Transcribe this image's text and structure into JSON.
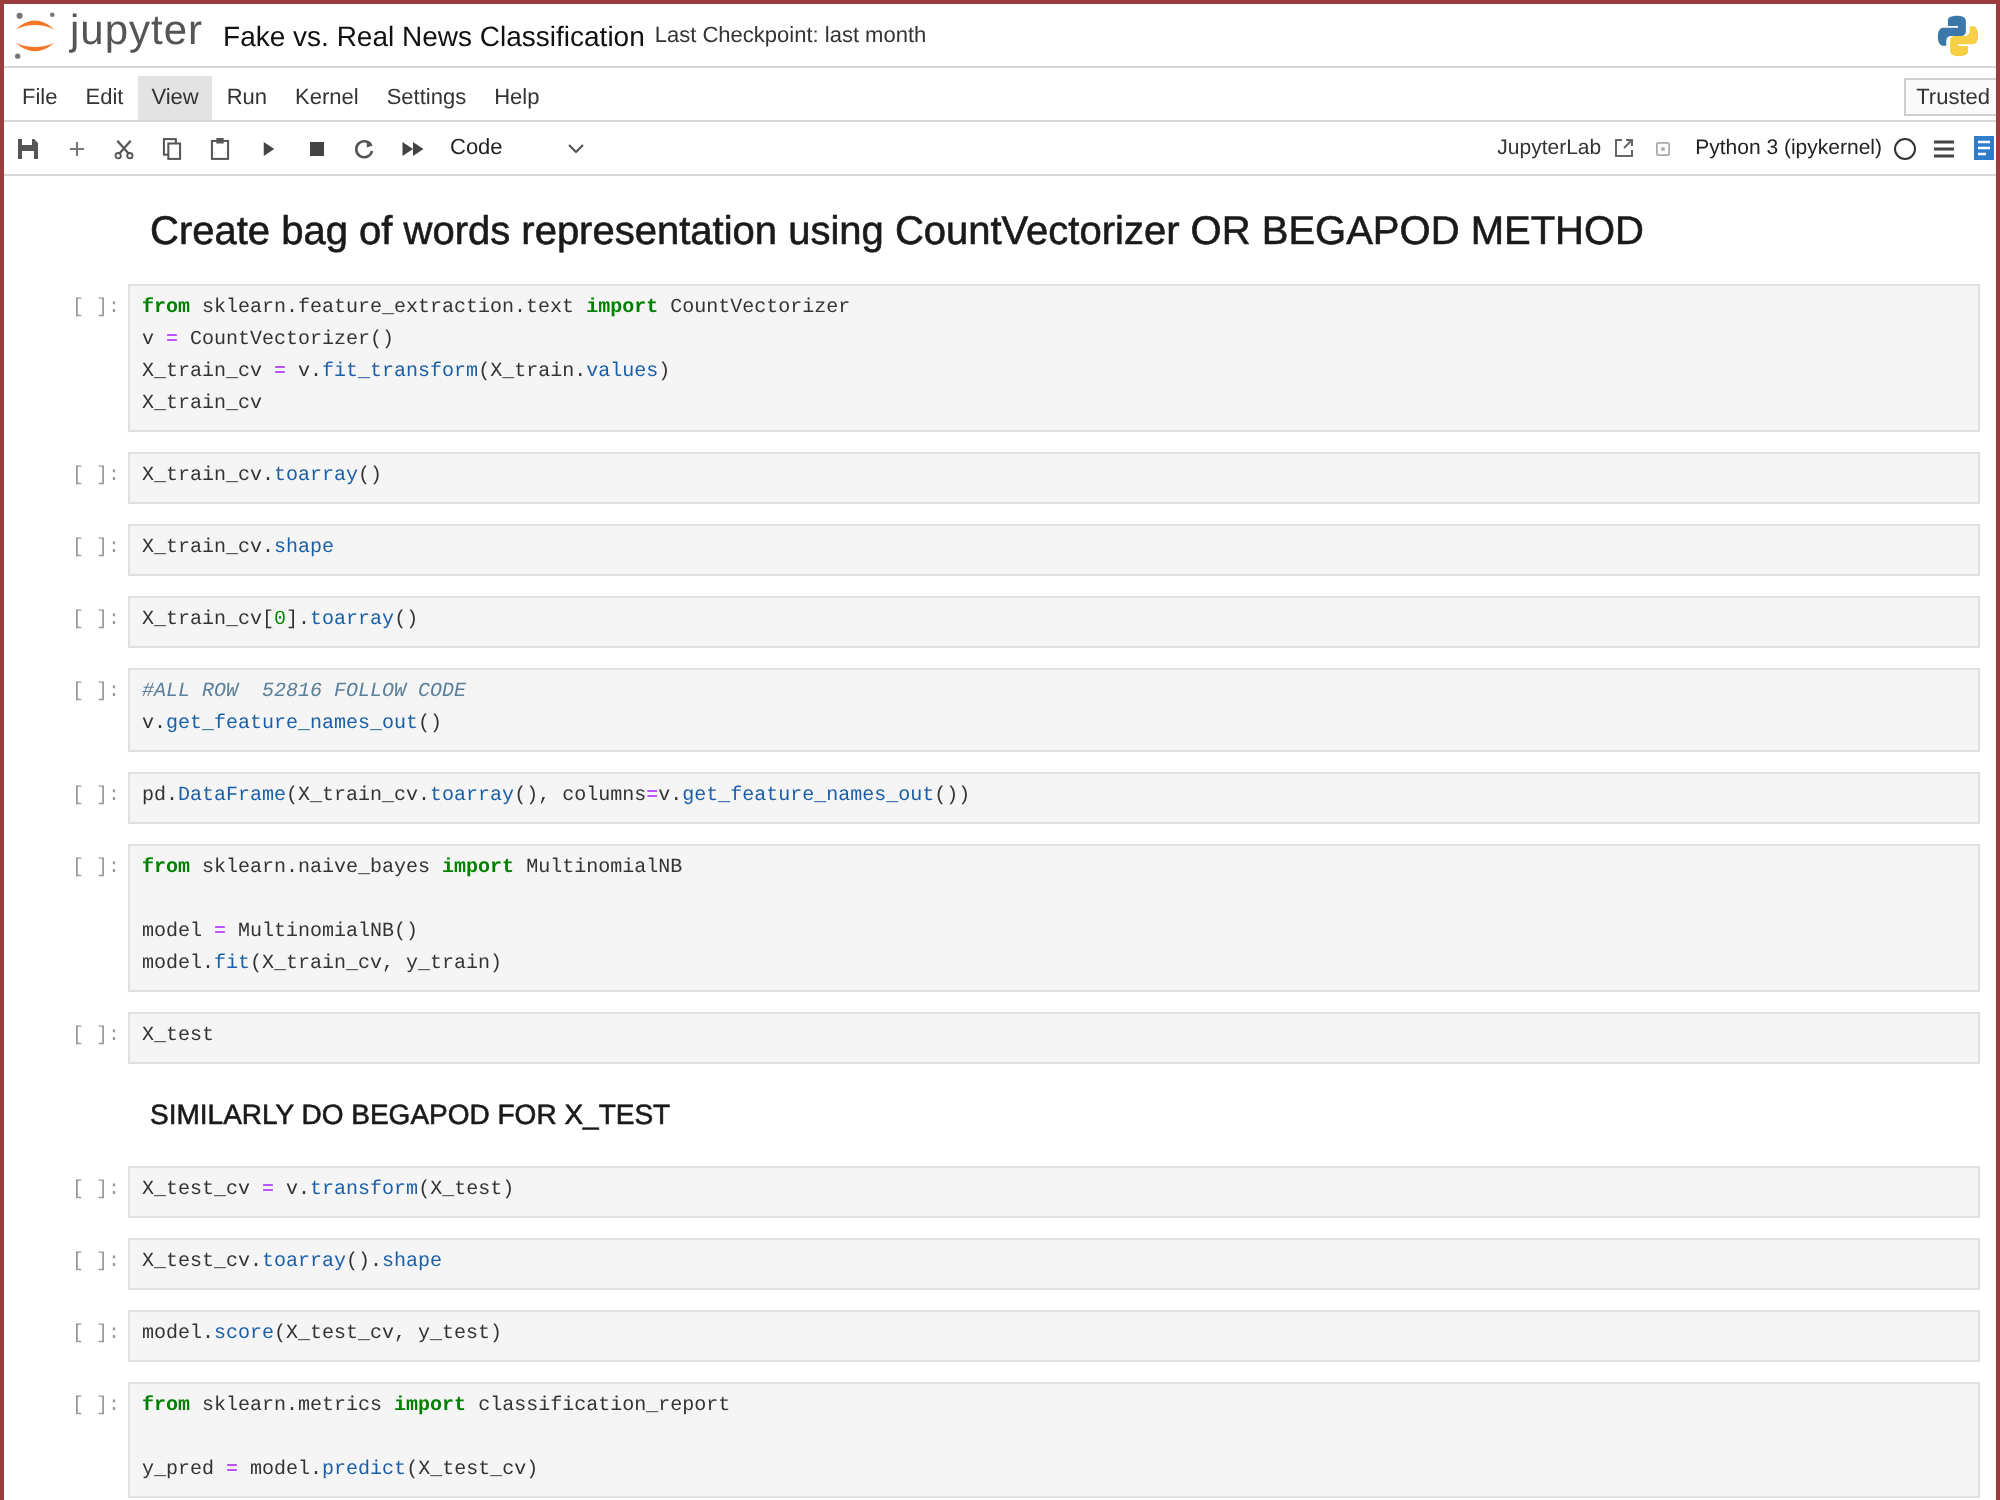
{
  "header": {
    "app_name": "jupyter",
    "notebook_title": "Fake vs. Real News Classification",
    "checkpoint": "Last Checkpoint: last month"
  },
  "menu_bar": {
    "items": [
      {
        "label": "File",
        "selected": false
      },
      {
        "label": "Edit",
        "selected": false
      },
      {
        "label": "View",
        "selected": true
      },
      {
        "label": "Run",
        "selected": false
      },
      {
        "label": "Kernel",
        "selected": false
      },
      {
        "label": "Settings",
        "selected": false
      },
      {
        "label": "Help",
        "selected": false
      }
    ],
    "trust_status": "Trusted"
  },
  "toolbar": {
    "cell_type": "Code",
    "open_in": "JupyterLab",
    "kernel": "Python 3 (ipykernel)",
    "kernel_busy": false
  },
  "notebook": {
    "cells": [
      {
        "kind": "h1",
        "text": "Create bag of words representation using CountVectorizer OR BEGAPOD METHOD"
      },
      {
        "kind": "code",
        "prompt": "[ ]:",
        "blocks": [
          [
            [
              {
                "kind": "keyword",
                "text": "from"
              },
              {
                "kind": "plain",
                "text": " sklearn.feature_extraction.text "
              },
              {
                "kind": "keyword",
                "text": "import"
              },
              {
                "kind": "plain",
                "text": " CountVectorizer"
              }
            ],
            [
              {
                "kind": "plain",
                "text": "v "
              },
              {
                "kind": "operator",
                "text": "="
              },
              {
                "kind": "plain",
                "text": " CountVectorizer()"
              }
            ],
            [
              {
                "kind": "plain",
                "text": "X_train_cv "
              },
              {
                "kind": "operator",
                "text": "="
              },
              {
                "kind": "plain",
                "text": " v."
              },
              {
                "kind": "property",
                "text": "fit_transform"
              },
              {
                "kind": "plain",
                "text": "(X_train."
              },
              {
                "kind": "property",
                "text": "values"
              },
              {
                "kind": "plain",
                "text": ")"
              }
            ],
            [
              {
                "kind": "plain",
                "text": "X_train_cv"
              }
            ]
          ]
        ]
      },
      {
        "kind": "code",
        "prompt": "[ ]:",
        "blocks": [
          [
            [
              {
                "kind": "plain",
                "text": "X_train_cv."
              },
              {
                "kind": "property",
                "text": "toarray"
              },
              {
                "kind": "plain",
                "text": "()"
              }
            ]
          ]
        ]
      },
      {
        "kind": "code",
        "prompt": "[ ]:",
        "blocks": [
          [
            [
              {
                "kind": "plain",
                "text": "X_train_cv."
              },
              {
                "kind": "property",
                "text": "shape"
              }
            ]
          ]
        ]
      },
      {
        "kind": "code",
        "prompt": "[ ]:",
        "blocks": [
          [
            [
              {
                "kind": "plain",
                "text": "X_train_cv["
              },
              {
                "kind": "number",
                "text": "0"
              },
              {
                "kind": "plain",
                "text": "]."
              },
              {
                "kind": "property",
                "text": "toarray"
              },
              {
                "kind": "plain",
                "text": "()"
              }
            ]
          ]
        ]
      },
      {
        "kind": "code",
        "prompt": "[ ]:",
        "blocks": [
          [
            [
              {
                "kind": "comment",
                "text": "#ALL ROW  52816 FOLLOW CODE"
              }
            ],
            [
              {
                "kind": "plain",
                "text": "v."
              },
              {
                "kind": "property",
                "text": "get_feature_names_out"
              },
              {
                "kind": "plain",
                "text": "()"
              }
            ]
          ]
        ]
      },
      {
        "kind": "code",
        "prompt": "[ ]:",
        "blocks": [
          [
            [
              {
                "kind": "plain",
                "text": "pd."
              },
              {
                "kind": "property",
                "text": "DataFrame"
              },
              {
                "kind": "plain",
                "text": "(X_train_cv."
              },
              {
                "kind": "property",
                "text": "toarray"
              },
              {
                "kind": "plain",
                "text": "(), columns"
              },
              {
                "kind": "operator",
                "text": "="
              },
              {
                "kind": "plain",
                "text": "v."
              },
              {
                "kind": "property",
                "text": "get_feature_names_out"
              },
              {
                "kind": "plain",
                "text": "())"
              }
            ]
          ]
        ]
      },
      {
        "kind": "code",
        "prompt": "[ ]:",
        "blocks": [
          [
            [
              {
                "kind": "keyword",
                "text": "from"
              },
              {
                "kind": "plain",
                "text": " sklearn.naive_bayes "
              },
              {
                "kind": "keyword",
                "text": "import"
              },
              {
                "kind": "plain",
                "text": " MultinomialNB"
              }
            ]
          ],
          [
            [
              {
                "kind": "plain",
                "text": "model "
              },
              {
                "kind": "operator",
                "text": "="
              },
              {
                "kind": "plain",
                "text": " MultinomialNB()"
              }
            ],
            [
              {
                "kind": "plain",
                "text": "model."
              },
              {
                "kind": "property",
                "text": "fit"
              },
              {
                "kind": "plain",
                "text": "(X_train_cv, y_train)"
              }
            ]
          ]
        ]
      },
      {
        "kind": "code",
        "prompt": "[ ]:",
        "blocks": [
          [
            [
              {
                "kind": "plain",
                "text": "X_test"
              }
            ]
          ]
        ]
      },
      {
        "kind": "h2",
        "text": "SIMILARLY DO BEGAPOD FOR X_TEST"
      },
      {
        "kind": "code",
        "prompt": "[ ]:",
        "blocks": [
          [
            [
              {
                "kind": "plain",
                "text": "X_test_cv "
              },
              {
                "kind": "operator",
                "text": "="
              },
              {
                "kind": "plain",
                "text": " v."
              },
              {
                "kind": "property",
                "text": "transform"
              },
              {
                "kind": "plain",
                "text": "(X_test)"
              }
            ]
          ]
        ]
      },
      {
        "kind": "code",
        "prompt": "[ ]:",
        "blocks": [
          [
            [
              {
                "kind": "plain",
                "text": "X_test_cv."
              },
              {
                "kind": "property",
                "text": "toarray"
              },
              {
                "kind": "plain",
                "text": "()."
              },
              {
                "kind": "property",
                "text": "shape"
              }
            ]
          ]
        ]
      },
      {
        "kind": "code",
        "prompt": "[ ]:",
        "blocks": [
          [
            [
              {
                "kind": "plain",
                "text": "model."
              },
              {
                "kind": "property",
                "text": "score"
              },
              {
                "kind": "plain",
                "text": "(X_test_cv, y_test)"
              }
            ]
          ]
        ]
      },
      {
        "kind": "code",
        "prompt": "[ ]:",
        "blocks": [
          [
            [
              {
                "kind": "keyword",
                "text": "from"
              },
              {
                "kind": "plain",
                "text": " sklearn.metrics "
              },
              {
                "kind": "keyword",
                "text": "import"
              },
              {
                "kind": "plain",
                "text": " classification_report"
              }
            ]
          ],
          [
            [
              {
                "kind": "plain",
                "text": "y_pred "
              },
              {
                "kind": "operator",
                "text": "="
              },
              {
                "kind": "plain",
                "text": " model."
              },
              {
                "kind": "property",
                "text": "predict"
              },
              {
                "kind": "plain",
                "text": "(X_test_cv)"
              }
            ]
          ]
        ]
      }
    ]
  }
}
